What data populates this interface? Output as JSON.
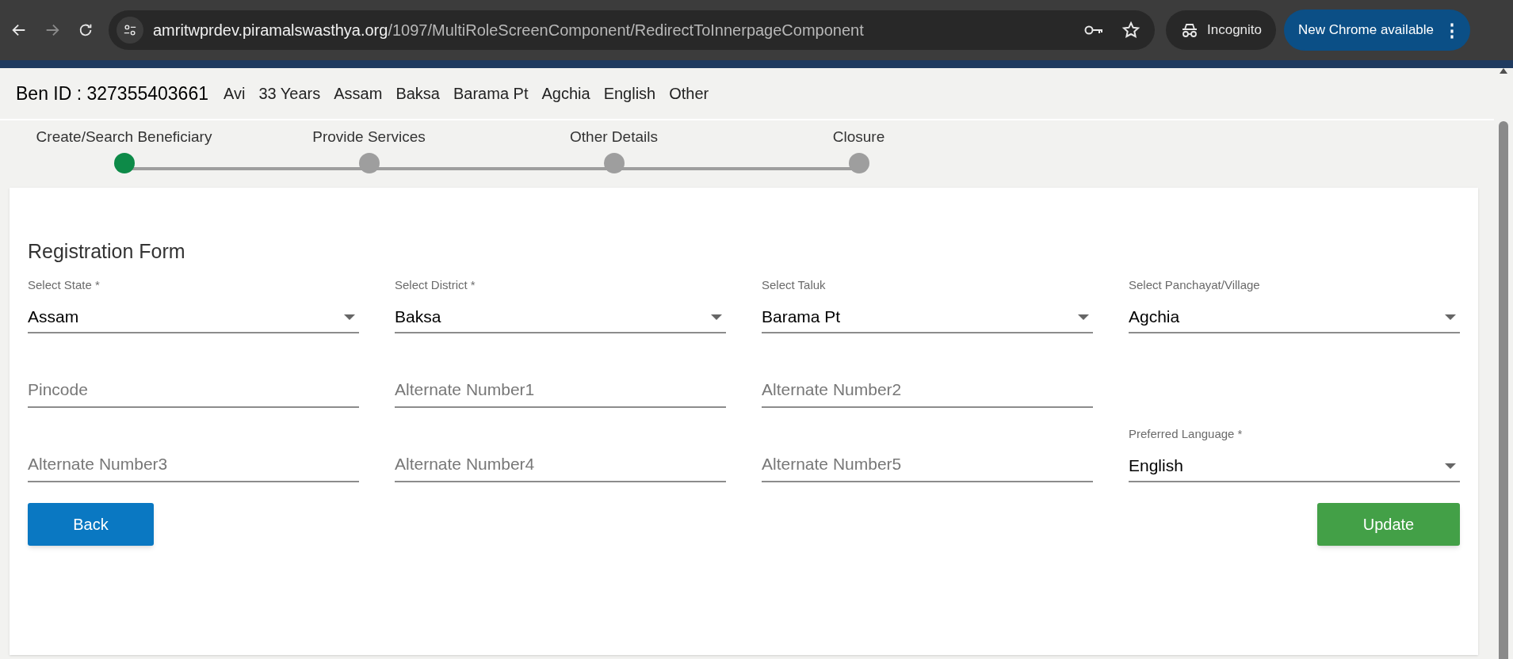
{
  "browser": {
    "url_host": "amritwprdev.piramalswasthya.org",
    "url_path": "/1097/MultiRoleScreenComponent/RedirectToInnerpageComponent",
    "profile": "Incognito",
    "update_button": "New Chrome available",
    "menu_glyph": "⋮"
  },
  "beneficiary": {
    "id_label": "Ben ID : 327355403661",
    "details": [
      "Avi",
      "33 Years",
      "Assam",
      "Baksa",
      "Barama Pt",
      "Agchia",
      "English",
      "Other"
    ]
  },
  "stepper": [
    {
      "label": "Create/Search Beneficiary",
      "selected": true
    },
    {
      "label": "Provide Services",
      "selected": false
    },
    {
      "label": "Other Details",
      "selected": false
    },
    {
      "label": "Closure",
      "selected": false
    }
  ],
  "form": {
    "title": "Registration Form",
    "rows": [
      {
        "fields": [
          {
            "kind": "select",
            "label": "Select State *",
            "value": "Assam"
          },
          {
            "kind": "select",
            "label": "Select District *",
            "value": "Baksa"
          },
          {
            "kind": "select",
            "label": "Select Taluk",
            "value": "Barama Pt"
          },
          {
            "kind": "select",
            "label": "Select Panchayat/Village",
            "value": "Agchia"
          }
        ]
      },
      {
        "fields": [
          {
            "kind": "input",
            "placeholder": "Pincode"
          },
          {
            "kind": "input",
            "placeholder": "Alternate Number1"
          },
          {
            "kind": "input",
            "placeholder": "Alternate Number2"
          }
        ]
      },
      {
        "fields": [
          {
            "kind": "input",
            "placeholder": "Alternate Number3"
          },
          {
            "kind": "input",
            "placeholder": "Alternate Number4"
          },
          {
            "kind": "input",
            "placeholder": "Alternate Number5"
          },
          {
            "kind": "select",
            "label": "Preferred Language *",
            "value": "English"
          }
        ]
      }
    ],
    "back_button": "Back",
    "update_button": "Update"
  }
}
